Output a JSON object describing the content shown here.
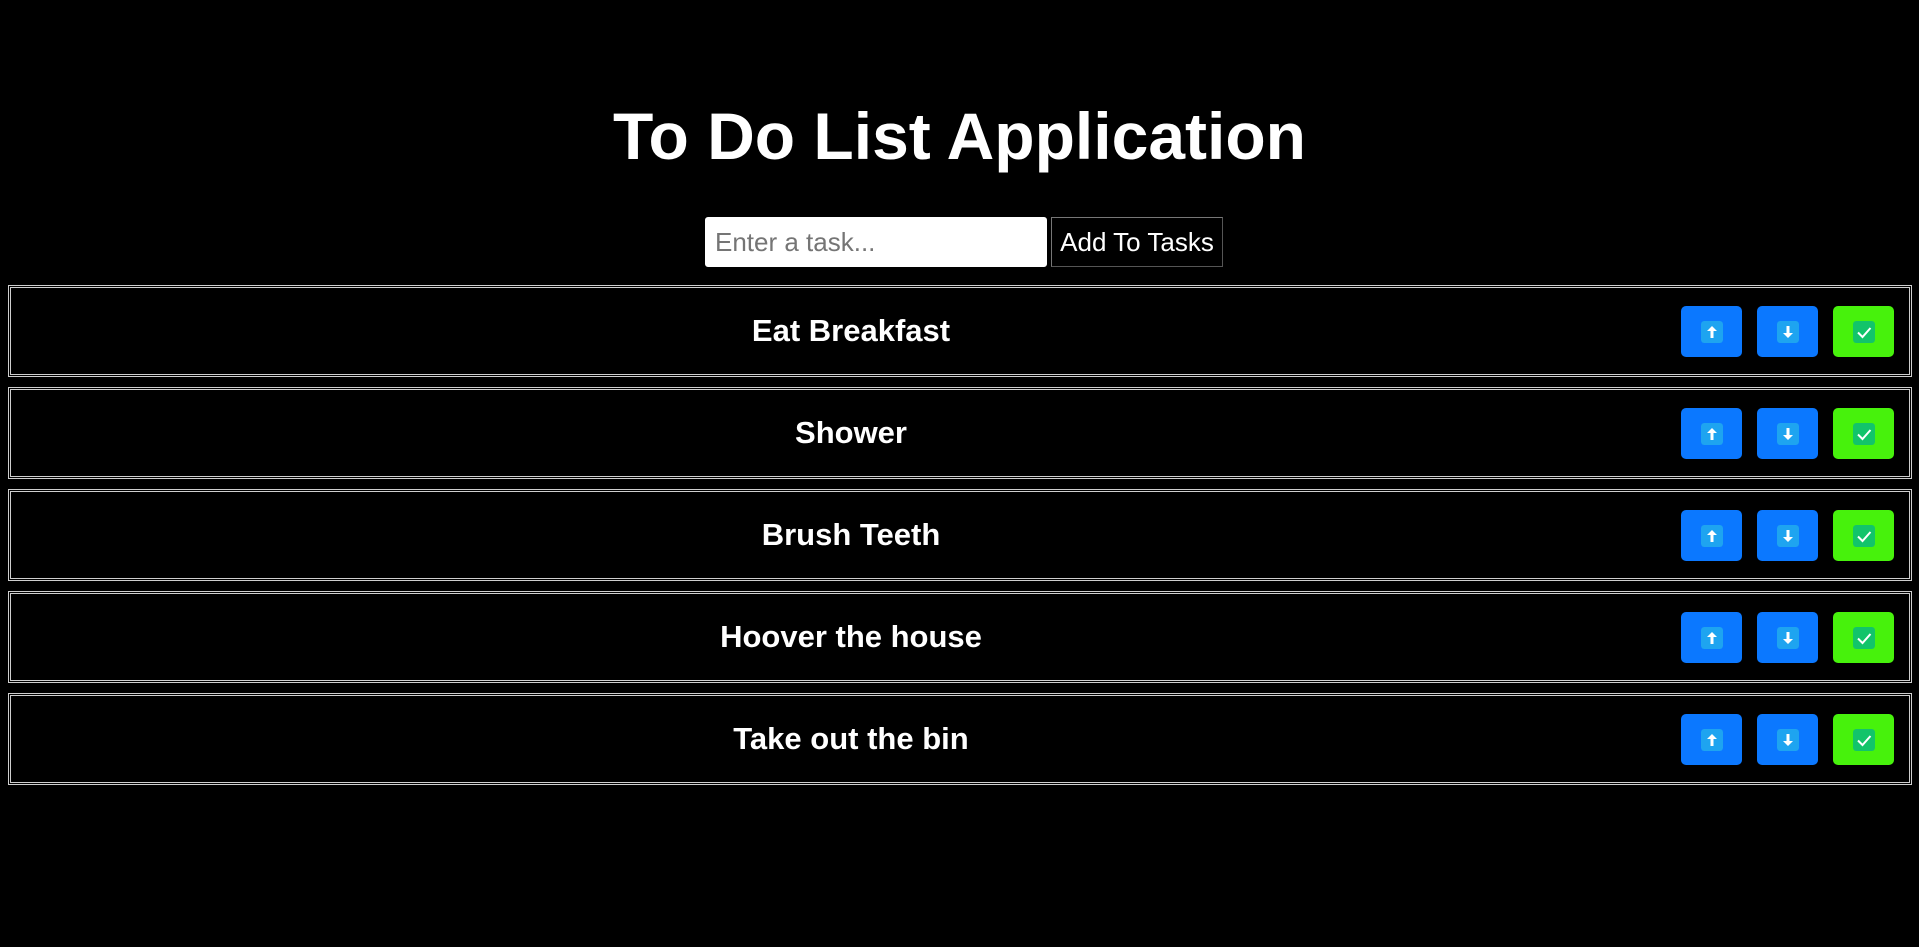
{
  "header": {
    "title": "To Do List Application"
  },
  "add_form": {
    "placeholder": "Enter a task...",
    "value": "",
    "button_label": "Add To Tasks"
  },
  "tasks": [
    {
      "label": "Eat Breakfast"
    },
    {
      "label": "Shower"
    },
    {
      "label": "Brush Teeth"
    },
    {
      "label": "Hoover the house"
    },
    {
      "label": "Take out the bin"
    }
  ],
  "icons": {
    "move_up": "arrow-up-icon",
    "move_down": "arrow-down-icon",
    "complete": "check-icon"
  },
  "colors": {
    "background": "#000000",
    "move_button": "#0b78ff",
    "complete_button": "#47f20c",
    "text": "#ffffff"
  }
}
